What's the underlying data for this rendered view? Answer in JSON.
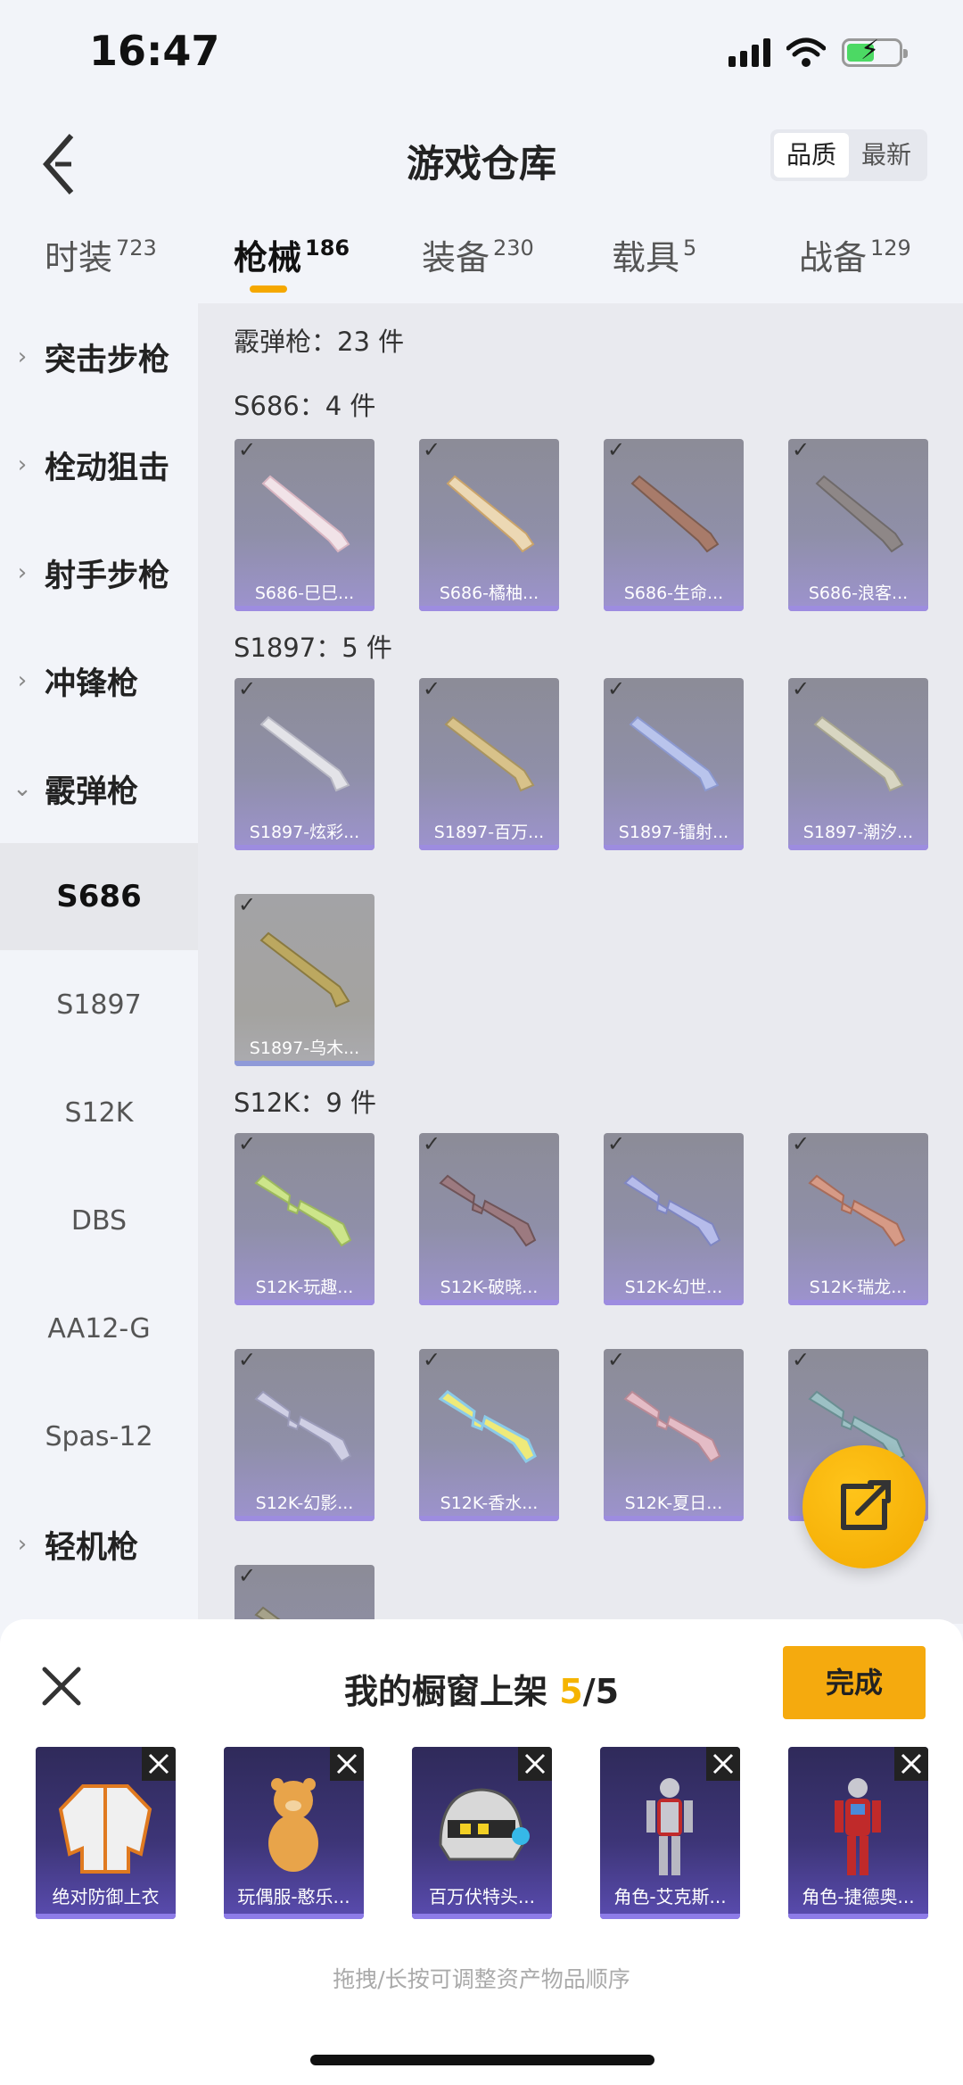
{
  "status": {
    "time": "16:47"
  },
  "header": {
    "title": "游戏仓库",
    "sort_quality": "品质",
    "sort_newest": "最新"
  },
  "tabs": [
    {
      "label": "时装",
      "count": "723"
    },
    {
      "label": "枪械",
      "count": "186"
    },
    {
      "label": "装备",
      "count": "230"
    },
    {
      "label": "载具",
      "count": "5"
    },
    {
      "label": "战备",
      "count": "129"
    }
  ],
  "sidebar": {
    "categories": [
      "突击步枪",
      "栓动狙击",
      "射手步枪",
      "冲锋枪",
      "霰弹枪",
      "轻机枪"
    ],
    "subitems": [
      "S686",
      "S1897",
      "S12K",
      "DBS",
      "AA12-G",
      "Spas-12"
    ]
  },
  "content": {
    "group_title": "霰弹枪：23 件",
    "sections": [
      {
        "title": "S686：4 件",
        "items": [
          "S686-巳巳...",
          "S686-橘柚...",
          "S686-生命...",
          "S686-浪客..."
        ]
      },
      {
        "title": "S1897：5 件",
        "items": [
          "S1897-炫彩...",
          "S1897-百万...",
          "S1897-镭射...",
          "S1897-潮汐...",
          "S1897-乌木..."
        ]
      },
      {
        "title": "S12K：9 件",
        "items": [
          "S12K-玩趣...",
          "S12K-破晓...",
          "S12K-幻世...",
          "S12K-瑞龙...",
          "S12K-幻影...",
          "S12K-香水...",
          "S12K-夏日...",
          ""
        ]
      }
    ]
  },
  "sheet": {
    "title": "我的橱窗上架",
    "count": "5",
    "total": "/5",
    "done_label": "完成",
    "items": [
      "绝对防御上衣",
      "玩偶服-憨乐...",
      "百万伏特头...",
      "角色-艾克斯...",
      "角色-捷德奥..."
    ],
    "hint": "拖拽/长按可调整资产物品顺序"
  },
  "colors": {
    "accent": "#f5aa0e",
    "item_purple": "#9d93cf"
  }
}
